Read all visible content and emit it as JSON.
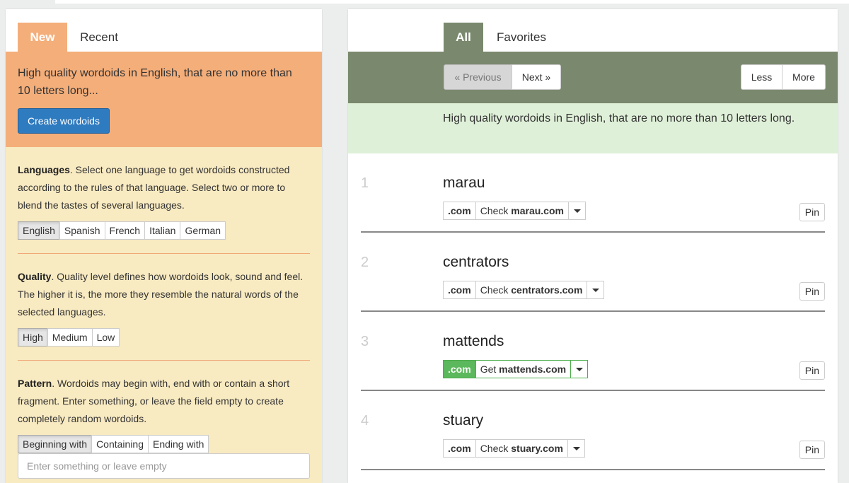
{
  "colors": {
    "orange": "#f4ae7a",
    "cream": "#f8eac1",
    "olive": "#7a896d",
    "mint": "#dff0d8",
    "blue_button": "#2f7bc0",
    "green_available": "#5cb85c"
  },
  "left": {
    "tabs": [
      {
        "label": "New",
        "active": true
      },
      {
        "label": "Recent",
        "active": false
      }
    ],
    "description": "High quality wordoids in English, that are no more than 10 letters long...",
    "create_label": "Create wordoids",
    "languages": {
      "title": "Languages",
      "text": ". Select one language to get wordoids constructed according to the rules of that language. Select two or more to blend the tastes of several languages.",
      "options": [
        "English",
        "Spanish",
        "French",
        "Italian",
        "German"
      ],
      "selected": "English"
    },
    "quality": {
      "title": "Quality",
      "text": ". Quality level defines how wordoids look, sound and feel. The higher it is, the more they resemble the natural words of the selected languages.",
      "options": [
        "High",
        "Medium",
        "Low"
      ],
      "selected": "High"
    },
    "pattern": {
      "title": "Pattern",
      "text": ". Wordoids may begin with, end with or contain a short fragment. Enter something, or leave the field empty to create completely random wordoids.",
      "options": [
        "Beginning with",
        "Containing",
        "Ending with"
      ],
      "selected": "Beginning with",
      "placeholder": "Enter something or leave empty"
    }
  },
  "right": {
    "tabs": [
      {
        "label": "All",
        "active": true
      },
      {
        "label": "Favorites",
        "active": false
      }
    ],
    "prev_label": "« Previous",
    "next_label": "Next »",
    "less_label": "Less",
    "more_label": "More",
    "info": "High quality wordoids in English, that are no more than 10 letters long.",
    "results": [
      {
        "num": "1",
        "word": "marau",
        "tld": ".com",
        "action": "Check",
        "domain": "marau.com",
        "available": false,
        "pin": "Pin"
      },
      {
        "num": "2",
        "word": "centrators",
        "tld": ".com",
        "action": "Check",
        "domain": "centrators.com",
        "available": false,
        "pin": "Pin"
      },
      {
        "num": "3",
        "word": "mattends",
        "tld": ".com",
        "action": "Get",
        "domain": "mattends.com",
        "available": true,
        "pin": "Pin"
      },
      {
        "num": "4",
        "word": "stuary",
        "tld": ".com",
        "action": "Check",
        "domain": "stuary.com",
        "available": false,
        "pin": "Pin"
      }
    ]
  }
}
